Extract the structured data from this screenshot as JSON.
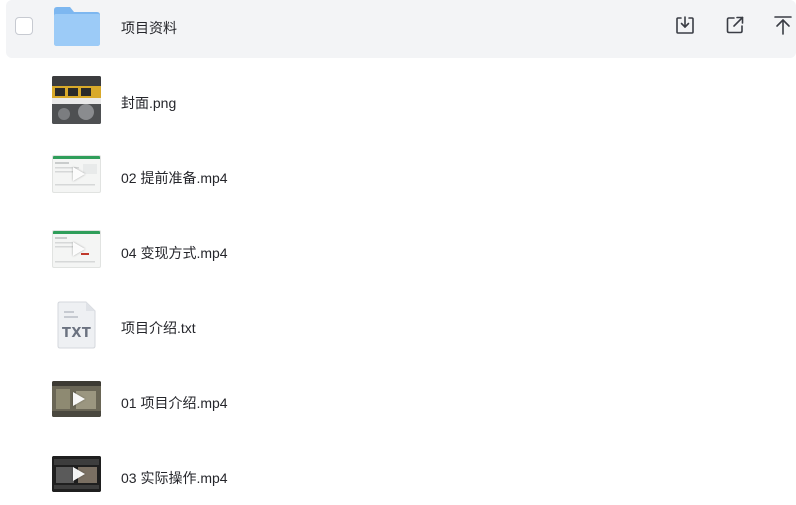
{
  "files": [
    {
      "name": "项目资料",
      "icon": "folder-icon"
    },
    {
      "name": "封面.png",
      "icon": "image-thumbnail"
    },
    {
      "name": "02 提前准备.mp4",
      "icon": "video-thumbnail"
    },
    {
      "name": "04 变现方式.mp4",
      "icon": "video-thumbnail"
    },
    {
      "name": "项目介绍.txt",
      "icon": "txt-file-icon",
      "badge": "TXT"
    },
    {
      "name": "01 项目介绍.mp4",
      "icon": "video-thumbnail"
    },
    {
      "name": "03 实际操作.mp4",
      "icon": "video-thumbnail"
    }
  ],
  "row_actions": [
    "download-icon",
    "share-icon",
    "pin-to-top-icon"
  ],
  "colors": {
    "hover_row": "#f3f4f6",
    "folder": "#8fc3f5",
    "text": "#25262b",
    "icon_stroke": "#3a3d45"
  }
}
